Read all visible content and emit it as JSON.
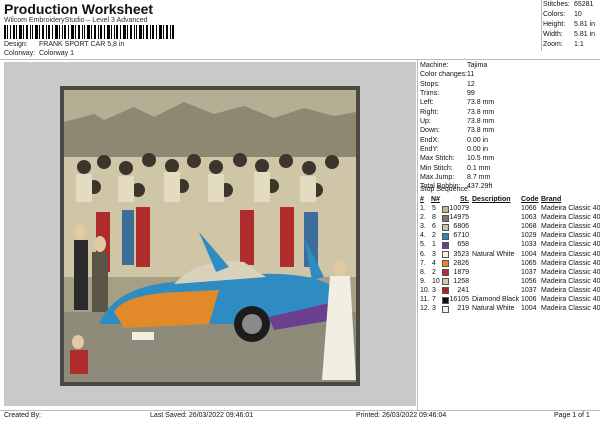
{
  "header": {
    "title": "Production Worksheet",
    "subtitle": "Wilcom EmbroideryStudio – Level 3 Advanced"
  },
  "summary": [
    {
      "label": "Stitches:",
      "value": "65281"
    },
    {
      "label": "Colors:",
      "value": "10"
    },
    {
      "label": "Height:",
      "value": "5.81 in"
    },
    {
      "label": "Width:",
      "value": "5.81 in"
    },
    {
      "label": "Zoom:",
      "value": "1:1"
    }
  ],
  "design_info": {
    "design_label": "Design:",
    "design_value": "FRANK SPORT CAR 5,8 in",
    "colorway_label": "Colorway:",
    "colorway_value": "Colorway 1"
  },
  "details": [
    {
      "label": "Machine:",
      "value": "Tajima"
    },
    {
      "label": "Color changes:",
      "value": "11"
    },
    {
      "label": "Stops:",
      "value": "12"
    },
    {
      "label": "Trims:",
      "value": "99"
    },
    {
      "label": "Left:",
      "value": "73.8 mm"
    },
    {
      "label": "Right:",
      "value": "73.8 mm"
    },
    {
      "label": "Up:",
      "value": "73.8 mm"
    },
    {
      "label": "Down:",
      "value": "73.8 mm"
    },
    {
      "label": "EndX:",
      "value": "0.00 in"
    },
    {
      "label": "EndY:",
      "value": "0.00 in"
    },
    {
      "label": "Max Stitch:",
      "value": "10.5 mm"
    },
    {
      "label": "Min Stitch:",
      "value": "0.1 mm"
    },
    {
      "label": "Max Jump:",
      "value": "8.7 mm"
    },
    {
      "label": "Total Bobbin:",
      "value": "437.29ft"
    }
  ],
  "sequence": {
    "title": "Stop Sequence:",
    "columns": [
      "#",
      "N#",
      "St.",
      "Description",
      "Code",
      "Brand"
    ],
    "rows": [
      {
        "n": "1.",
        "needle": "5",
        "color": "#c8b68a",
        "st": "10079",
        "desc": "",
        "code": "1066",
        "brand": "Madeira Classic 40"
      },
      {
        "n": "2.",
        "needle": "8",
        "color": "#7a7a6a",
        "st": "14975",
        "desc": "",
        "code": "1063",
        "brand": "Madeira Classic 40"
      },
      {
        "n": "3.",
        "needle": "6",
        "color": "#c9c2b0",
        "st": "6806",
        "desc": "",
        "code": "1068",
        "brand": "Madeira Classic 40"
      },
      {
        "n": "4.",
        "needle": "2",
        "color": "#2e86b8",
        "st": "6710",
        "desc": "",
        "code": "1029",
        "brand": "Madeira Classic 40"
      },
      {
        "n": "5.",
        "needle": "1",
        "color": "#6a3f8e",
        "st": "658",
        "desc": "",
        "code": "1033",
        "brand": "Madeira Classic 40"
      },
      {
        "n": "6.",
        "needle": "3",
        "color": "#f4f1e6",
        "st": "3523",
        "desc": "Natural White",
        "code": "1004",
        "brand": "Madeira Classic 40"
      },
      {
        "n": "7.",
        "needle": "4",
        "color": "#e08a2a",
        "st": "2826",
        "desc": "",
        "code": "1065",
        "brand": "Madeira Classic 40"
      },
      {
        "n": "8.",
        "needle": "2",
        "color": "#c02a2a",
        "st": "1879",
        "desc": "",
        "code": "1037",
        "brand": "Madeira Classic 40"
      },
      {
        "n": "9.",
        "needle": "10",
        "color": "#d6c8a6",
        "st": "1258",
        "desc": "",
        "code": "1056",
        "brand": "Madeira Classic 40"
      },
      {
        "n": "10.",
        "needle": "3",
        "color": "#b02020",
        "st": "241",
        "desc": "",
        "code": "1037",
        "brand": "Madeira Classic 40"
      },
      {
        "n": "11.",
        "needle": "7",
        "color": "#111111",
        "st": "16105",
        "desc": "Diamond Black",
        "code": "1006",
        "brand": "Madeira Classic 40"
      },
      {
        "n": "12.",
        "needle": "3",
        "color": "#f4f1e6",
        "st": "219",
        "desc": "Natural White",
        "code": "1004",
        "brand": "Madeira Classic 40"
      }
    ]
  },
  "footer": {
    "created_by": "Created By:",
    "last_saved": "Last Saved: 26/03/2022 09:46:01",
    "printed": "Printed: 26/03/2022 09:46:04",
    "page": "Page 1 of 1"
  }
}
